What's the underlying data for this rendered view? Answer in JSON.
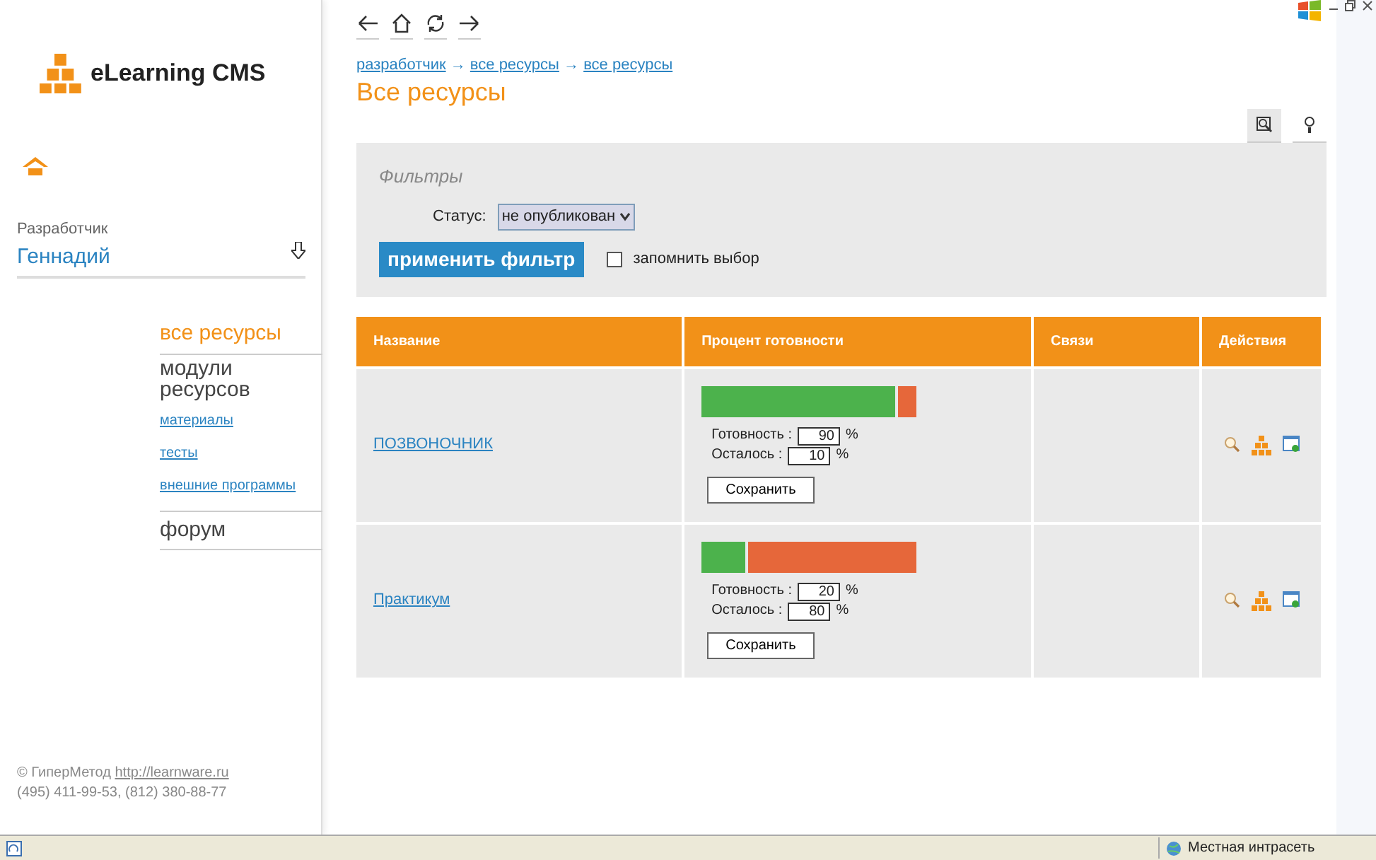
{
  "logo": {
    "text": "eLearning CMS"
  },
  "user": {
    "role": "Разработчик",
    "name": "Геннадий"
  },
  "nav": [
    {
      "label": "все ресурсы",
      "kind": "section",
      "selected": true
    },
    {
      "label": "модули ресурсов",
      "kind": "heading",
      "selected": false,
      "children": [
        {
          "label": "материалы"
        },
        {
          "label": "тесты"
        },
        {
          "label": "внешние программы"
        }
      ]
    },
    {
      "label": "форум",
      "kind": "section",
      "selected": false
    }
  ],
  "footer": {
    "copyright": "© ГиперМетод",
    "link": "http://learnware.ru",
    "phones": "(495) 411-99-53, (812) 380-88-77"
  },
  "breadcrumbs": [
    "разработчик",
    "все ресурсы",
    "все ресурсы"
  ],
  "breadcrumb_separator": "→",
  "page_title": "Все ресурсы",
  "view_tools": [
    {
      "kind": "search",
      "selected": true
    },
    {
      "kind": "help",
      "selected": false
    }
  ],
  "filters": {
    "title": "Фильтры",
    "status_label": "Статус:",
    "status_value": "не опубликован",
    "apply_button": "применить фильтр",
    "remember_label": "запомнить выбор",
    "remember_checked": false
  },
  "table": {
    "columns": [
      "Название",
      "Процент готовности",
      "Связи",
      "Действия"
    ],
    "rows": [
      {
        "name": "ПОЗВОНОЧНИК",
        "level": 0.9,
        "ready_label": "Готовность :",
        "ready_value": "90",
        "left_label": "Осталось :",
        "left_value": "10",
        "unit": "%",
        "save_button": "Сохранить"
      },
      {
        "name": "Практикум",
        "level": 0.2,
        "ready_label": "Готовность :",
        "ready_value": "20",
        "left_label": "Осталось :",
        "left_value": "80",
        "unit": "%",
        "save_button": "Сохранить"
      }
    ]
  },
  "status_bar": {
    "zone": "Местная интрасеть"
  }
}
